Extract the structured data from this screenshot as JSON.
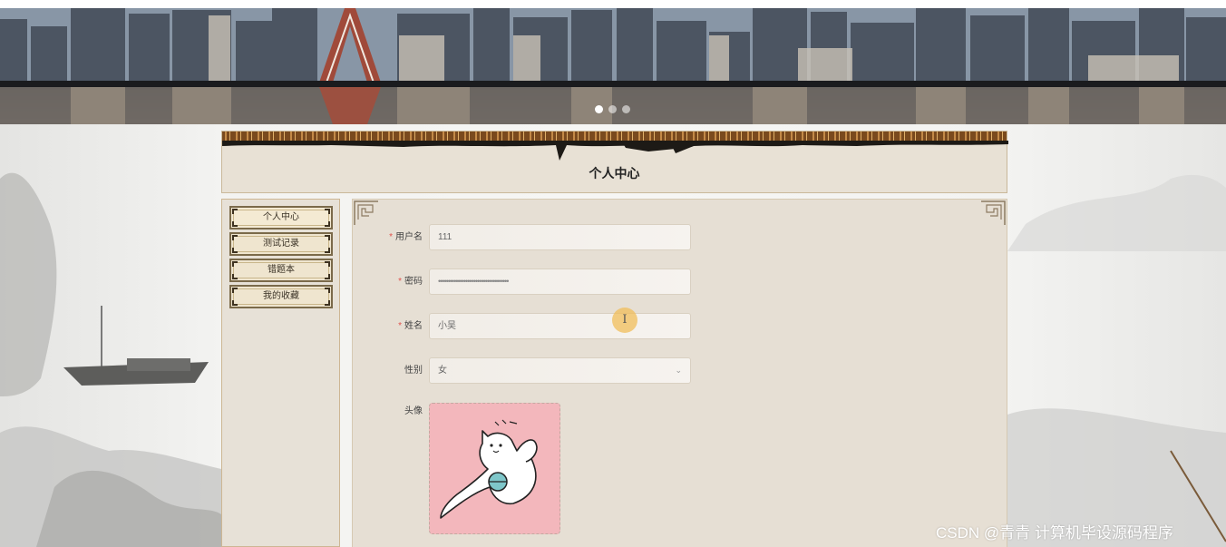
{
  "banner": {
    "slides": 3,
    "active_slide": 1
  },
  "page_title": "个人中心",
  "sidebar": {
    "items": [
      {
        "label": "个人中心",
        "active": true
      },
      {
        "label": "测试记录",
        "active": false
      },
      {
        "label": "错题本",
        "active": false
      },
      {
        "label": "我的收藏",
        "active": false
      }
    ]
  },
  "form": {
    "username": {
      "label": "用户名",
      "required": true,
      "value": "111"
    },
    "password": {
      "label": "密码",
      "required": true,
      "value": "••••••••••••••••••••••••••••••••••••"
    },
    "name": {
      "label": "姓名",
      "required": true,
      "value": "小吴"
    },
    "gender": {
      "label": "性别",
      "required": false,
      "value": "女"
    },
    "avatar": {
      "label": "头像",
      "required": false
    }
  },
  "cursor_glyph": "I",
  "watermark": "CSDN @青青  计算机毕设源码程序",
  "colors": {
    "required_star": "#e0524d",
    "avatar_bg": "#f3b7bc",
    "panel_bg": "#e6dfd4",
    "border_trim": "#7a4a1e"
  }
}
